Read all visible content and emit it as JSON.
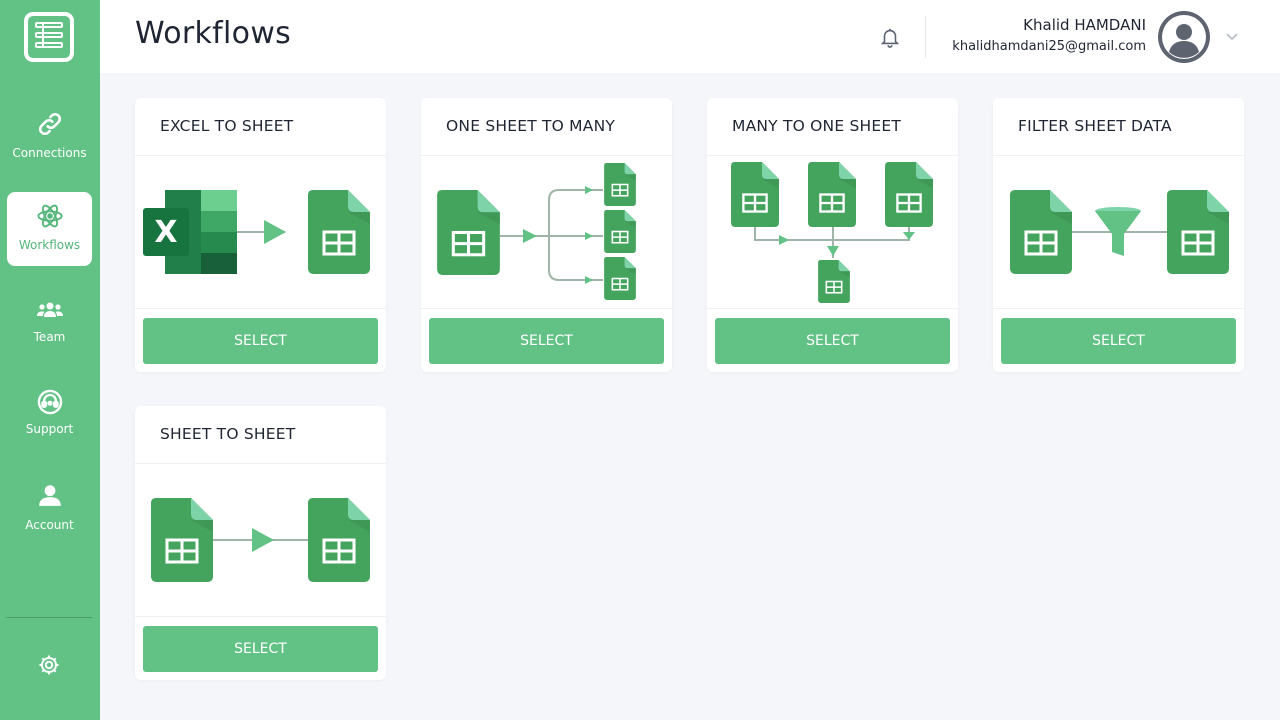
{
  "app": {
    "page_title": "Workflows",
    "accent_color": "#62c286"
  },
  "sidebar": {
    "logo_icon": "spreadsheet-logo-icon",
    "items": [
      {
        "label": "Connections",
        "icon": "link-icon",
        "active": false
      },
      {
        "label": "Workflows",
        "icon": "atom-icon",
        "active": true
      },
      {
        "label": "Team",
        "icon": "team-icon",
        "active": false
      },
      {
        "label": "Support",
        "icon": "headset-icon",
        "active": false
      },
      {
        "label": "Account",
        "icon": "user-icon",
        "active": false
      }
    ],
    "settings_icon": "gear-icon"
  },
  "header": {
    "notification_icon": "bell-icon",
    "user": {
      "name": "Khalid HAMDANI",
      "email": "khalidhamdani25@gmail.com",
      "avatar_icon": "avatar-icon",
      "menu_icon": "chevron-down-icon"
    }
  },
  "workflows": [
    {
      "title": "EXCEL TO SHEET",
      "button": "SELECT"
    },
    {
      "title": "ONE SHEET TO MANY",
      "button": "SELECT"
    },
    {
      "title": "MANY TO ONE SHEET",
      "button": "SELECT"
    },
    {
      "title": "FILTER SHEET DATA",
      "button": "SELECT"
    },
    {
      "title": "SHEET TO SHEET",
      "button": "SELECT"
    }
  ]
}
